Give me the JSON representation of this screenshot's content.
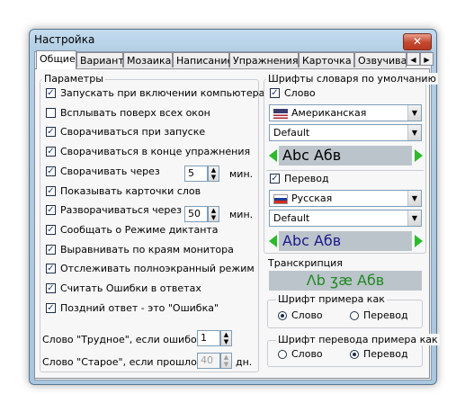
{
  "window": {
    "title": "Настройка",
    "close_glyph": "✕"
  },
  "tabs": [
    {
      "label": "Общие",
      "active": true
    },
    {
      "label": "Вариант"
    },
    {
      "label": "Мозаика"
    },
    {
      "label": "Написание"
    },
    {
      "label": "Упражнения"
    },
    {
      "label": "Карточка"
    },
    {
      "label": "Озвучива"
    }
  ],
  "tab_scroll": {
    "left": "◀",
    "right": "▶"
  },
  "params": {
    "legend": "Параметры",
    "options": [
      {
        "label": "Запускать при включении компьютера",
        "checked": true
      },
      {
        "label": "Всплывать поверх всех окон",
        "checked": false
      },
      {
        "label": "Сворачиваться при запуске",
        "checked": true
      },
      {
        "label": "Сворачиваться в конце упражнения",
        "checked": true
      },
      {
        "label": "Сворачивать через",
        "checked": true
      },
      {
        "label": "Показывать карточки слов",
        "checked": true
      },
      {
        "label": "Разворачиваться через",
        "checked": true
      },
      {
        "label": "Сообщать о Режиме диктанта",
        "checked": true
      },
      {
        "label": "Выравнивать по краям монитора",
        "checked": true
      },
      {
        "label": "Отслеживать полноэкранный режим",
        "checked": true
      },
      {
        "label": "Считать Ошибки в ответах",
        "checked": true
      },
      {
        "label": "Поздний ответ - это \"Ошибка\"",
        "checked": true
      }
    ],
    "check_glyph": "✓",
    "minimize_after": {
      "value": "5",
      "unit": "мин."
    },
    "restore_after": {
      "value": "50",
      "unit": "мин."
    },
    "hard_word": {
      "label": "Слово \"Трудное\", если ошибок >",
      "value": "1"
    },
    "old_word": {
      "label": "Слово \"Старое\", если прошло >",
      "value": "40",
      "unit": "дн."
    }
  },
  "spin_glyphs": {
    "up": "▲",
    "down": "▼"
  },
  "fonts": {
    "legend": "Шрифты словаря по умолчанию",
    "word": {
      "label": "Слово",
      "checked": true,
      "language": "Американская",
      "font": "Default",
      "preview": "Abc Абв"
    },
    "translation": {
      "label": "Перевод",
      "checked": true,
      "language": "Русская",
      "font": "Default",
      "preview": "Abc Абв"
    },
    "combo_arrow": "▼"
  },
  "transcription": {
    "label": "Транскрипция",
    "preview": "Λb ʒæ Абв"
  },
  "example_font": {
    "legend": "Шрифт примера как",
    "options": [
      {
        "label": "Слово",
        "selected": true
      },
      {
        "label": "Перевод",
        "selected": false
      }
    ]
  },
  "example_translation_font": {
    "legend": "Шрифт перевода примера как",
    "options": [
      {
        "label": "Слово",
        "selected": false
      },
      {
        "label": "Перевод",
        "selected": true
      }
    ]
  },
  "colors": {
    "accent_green": "#2cbb2c",
    "preview_bg": "#bcc4cb",
    "translation_text": "#1a1a8c",
    "transcription_text": "#1f8a1f"
  }
}
